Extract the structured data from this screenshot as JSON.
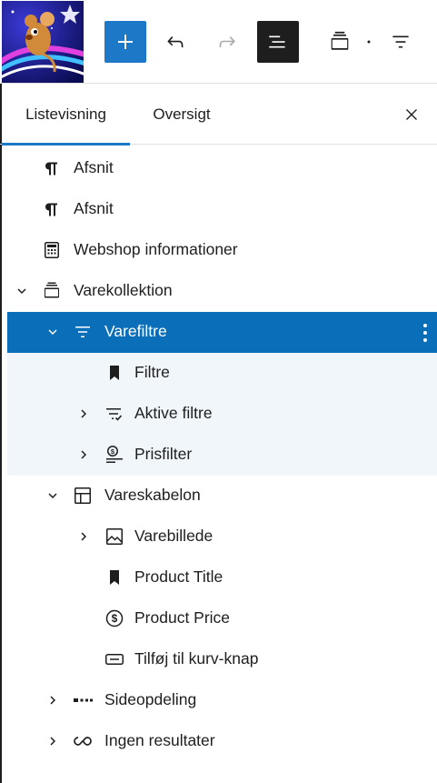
{
  "toolbar": {
    "logo_icon": "mouse-rocket-logo",
    "add_icon": "plus-icon",
    "undo_icon": "undo-icon",
    "redo_icon": "redo-icon",
    "list_view_icon": "list-view-icon",
    "block_icon": "query-loop-icon",
    "filter_icon": "filter-icon",
    "accent_color": "#1e78c8"
  },
  "tabs": {
    "list_view": "Listevisning",
    "overview": "Oversigt"
  },
  "tree": [
    {
      "label": "Afsnit",
      "icon": "paragraph-icon"
    },
    {
      "label": "Afsnit",
      "icon": "paragraph-icon"
    },
    {
      "label": "Webshop informationer",
      "icon": "calculator-icon"
    },
    {
      "label": "Varekollektion",
      "icon": "collection-icon",
      "expanded": true
    },
    {
      "label": "Varefiltre",
      "icon": "filter-icon",
      "expanded": true,
      "selected": true
    },
    {
      "label": "Filtre",
      "icon": "bookmark-icon"
    },
    {
      "label": "Aktive filtre",
      "icon": "active-filter-icon",
      "expandable": true
    },
    {
      "label": "Prisfilter",
      "icon": "price-filter-icon",
      "expandable": true
    },
    {
      "label": "Vareskabelon",
      "icon": "layout-icon",
      "expanded": true
    },
    {
      "label": "Varebillede",
      "icon": "image-icon",
      "expandable": true
    },
    {
      "label": "Product Title",
      "icon": "bookmark-icon"
    },
    {
      "label": "Product Price",
      "icon": "dollar-circle-icon"
    },
    {
      "label": "Tilføj til kurv-knap",
      "icon": "button-icon"
    },
    {
      "label": "Sideopdeling",
      "icon": "pagination-icon",
      "expandable": true
    },
    {
      "label": "Ingen resultater",
      "icon": "loop-icon",
      "expandable": true
    }
  ]
}
